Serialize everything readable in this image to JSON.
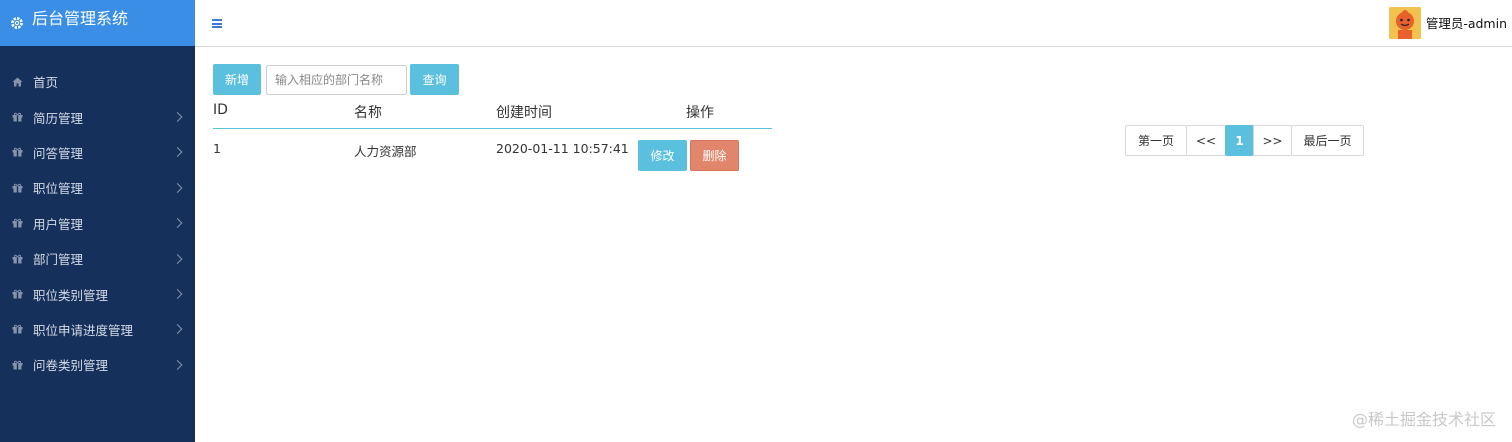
{
  "app": {
    "title": "后台管理系统"
  },
  "sidebar": {
    "items": [
      {
        "label": "首页",
        "icon": "home-icon",
        "has_arrow": false
      },
      {
        "label": "简历管理",
        "icon": "gift-icon",
        "has_arrow": true
      },
      {
        "label": "问答管理",
        "icon": "gift-icon",
        "has_arrow": true
      },
      {
        "label": "职位管理",
        "icon": "gift-icon",
        "has_arrow": true
      },
      {
        "label": "用户管理",
        "icon": "gift-icon",
        "has_arrow": true
      },
      {
        "label": "部门管理",
        "icon": "gift-icon",
        "has_arrow": true
      },
      {
        "label": "职位类别管理",
        "icon": "gift-icon",
        "has_arrow": true
      },
      {
        "label": "职位申请进度管理",
        "icon": "gift-icon",
        "has_arrow": true
      },
      {
        "label": "问卷类别管理",
        "icon": "gift-icon",
        "has_arrow": true
      }
    ]
  },
  "header": {
    "user_name": "管理员-admin"
  },
  "toolbar": {
    "add_label": "新增",
    "search_placeholder": "输入相应的部门名称",
    "search_value": "",
    "query_label": "查询"
  },
  "table": {
    "columns": [
      "ID",
      "名称",
      "创建时间",
      "操作"
    ],
    "rows": [
      {
        "id": "1",
        "name": "人力资源部",
        "created": "2020-01-11 10:57:41",
        "edit_label": "修改",
        "delete_label": "删除"
      }
    ]
  },
  "pagination": {
    "first_label": "第一页",
    "prev_label": "<<",
    "current_page": "1",
    "next_label": ">>",
    "last_label": "最后一页"
  },
  "watermark": "@稀土掘金技术社区",
  "colors": {
    "sidebar_bg": "#15305b",
    "brand_bg": "#3a8ee6",
    "accent": "#5bc0de",
    "danger": "#e2866b"
  }
}
